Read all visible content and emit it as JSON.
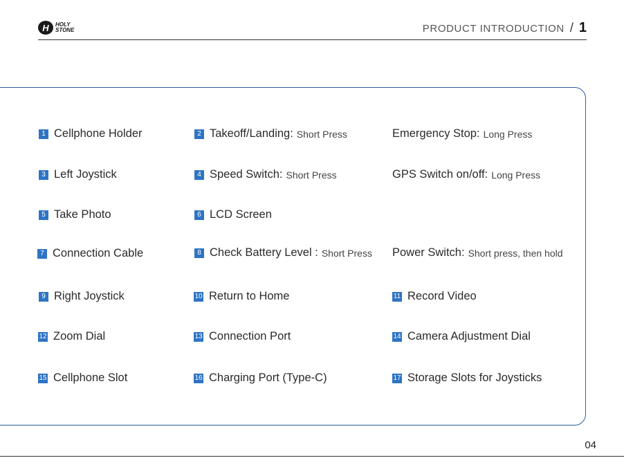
{
  "logo": {
    "mark": "H",
    "line1": "HOLY",
    "line2": "STONE"
  },
  "header": {
    "title": "PRODUCT INTRODUCTION",
    "slash": "/",
    "page_index": "1"
  },
  "items": [
    {
      "num": "1",
      "label": "Cellphone Holder"
    },
    {
      "num": "2",
      "label": "Takeoff/Landing:",
      "sub": "Short Press"
    },
    {
      "label": "Emergency Stop:",
      "sub": "Long Press"
    },
    {
      "num": "3",
      "label": "Left Joystick"
    },
    {
      "num": "4",
      "label": "Speed Switch:",
      "sub": "Short Press"
    },
    {
      "label": "GPS Switch on/off:",
      "sub": "Long Press"
    },
    {
      "num": "5",
      "label": "Take Photo"
    },
    {
      "num": "6",
      "label": "LCD Screen"
    },
    {
      "num": "7",
      "label": "Connection Cable"
    },
    {
      "num": "8",
      "label": "Check Battery Level :",
      "sub": "Short Press"
    },
    {
      "label": "Power Switch:",
      "sub": "Short press, then hold"
    },
    {
      "num": "9",
      "label": "Right Joystick"
    },
    {
      "num": "10",
      "label": "Return to Home"
    },
    {
      "num": "11",
      "label": "Record Video"
    },
    {
      "num": "12",
      "label": "Zoom Dial"
    },
    {
      "num": "13",
      "label": "Connection Port"
    },
    {
      "num": "14",
      "label": "Camera Adjustment Dial"
    },
    {
      "num": "15",
      "label": "Cellphone Slot"
    },
    {
      "num": "16",
      "label": "Charging Port (Type-C)"
    },
    {
      "num": "17",
      "label": "Storage Slots for Joysticks"
    }
  ],
  "footer": {
    "page_number": "04"
  },
  "colors": {
    "accent": "#2e74c4",
    "border": "#2b5f9e"
  }
}
